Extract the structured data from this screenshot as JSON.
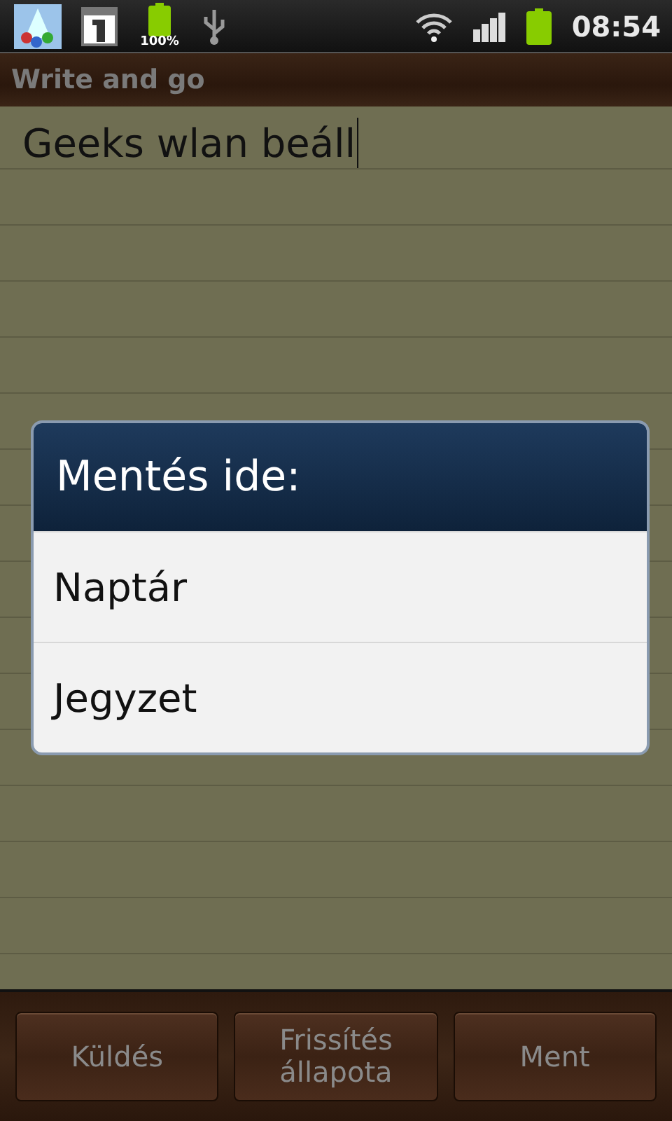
{
  "status_bar": {
    "battery_label": "100%",
    "time": "08:54"
  },
  "app_title": "Write and go",
  "note": {
    "value": "Geeks wlan beáll"
  },
  "dialog": {
    "title": "Mentés ide:",
    "options": [
      "Naptár",
      "Jegyzet"
    ]
  },
  "buttons": [
    {
      "label": "Küldés"
    },
    {
      "label": "Frissítés\nállapota"
    },
    {
      "label": "Ment"
    }
  ]
}
